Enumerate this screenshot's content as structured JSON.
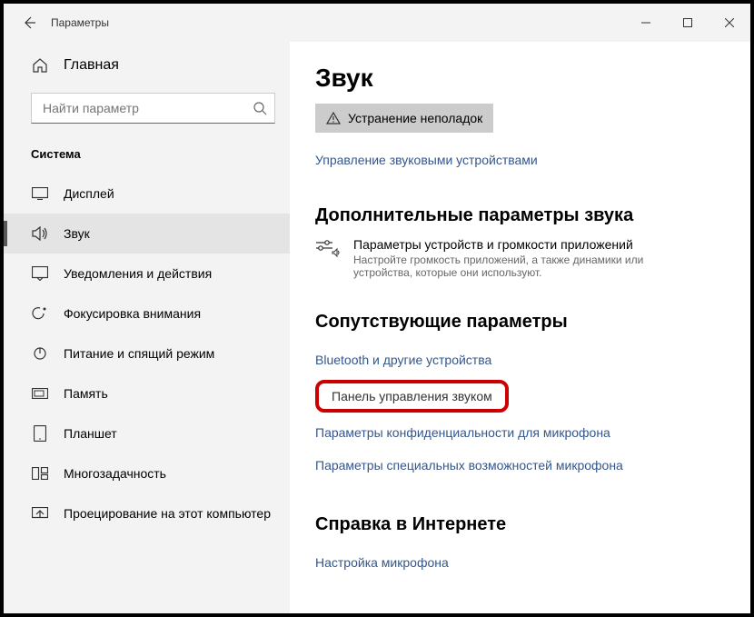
{
  "window": {
    "title": "Параметры"
  },
  "sidebar": {
    "home": "Главная",
    "search_placeholder": "Найти параметр",
    "section": "Система",
    "items": [
      {
        "label": "Дисплей"
      },
      {
        "label": "Звук"
      },
      {
        "label": "Уведомления и действия"
      },
      {
        "label": "Фокусировка внимания"
      },
      {
        "label": "Питание и спящий режим"
      },
      {
        "label": "Память"
      },
      {
        "label": "Планшет"
      },
      {
        "label": "Многозадачность"
      },
      {
        "label": "Проецирование на этот компьютер"
      }
    ]
  },
  "content": {
    "h1": "Звук",
    "troubleshoot": "Устранение неполадок",
    "manage_devices": "Управление звуковыми устройствами",
    "advanced_h2": "Дополнительные параметры звука",
    "app_volume_title": "Параметры устройств и громкости приложений",
    "app_volume_desc": "Настройте громкость приложений, а также динамики или устройства, которые они используют.",
    "related_h2": "Сопутствующие параметры",
    "related": [
      "Bluetooth и другие устройства",
      "Панель управления звуком",
      "Параметры конфиденциальности для микрофона",
      "Параметры специальных возможностей микрофона"
    ],
    "help_h2": "Справка в Интернете",
    "help_link": "Настройка микрофона"
  }
}
